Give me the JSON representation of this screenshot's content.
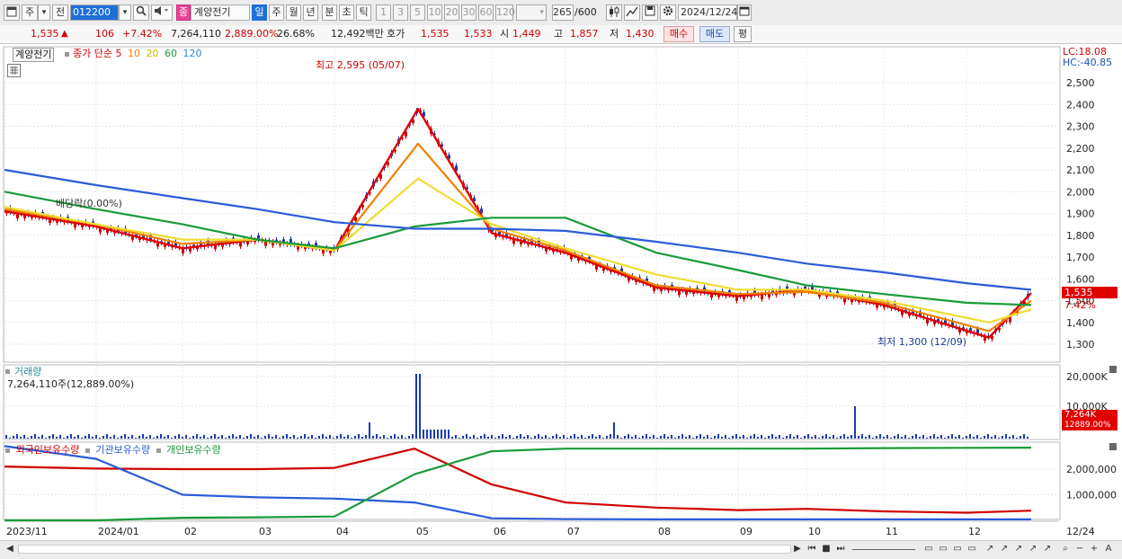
{
  "toolbar": {
    "market": "주",
    "dropdown_arrow": "▾",
    "prev_label": "전",
    "code": "012200",
    "search_icon": "search-icon",
    "sound_icon": "speaker-icon",
    "badge": "종",
    "name": "계양전기",
    "periods": [
      "일",
      "주",
      "월",
      "년",
      "분",
      "초",
      "틱"
    ],
    "selected_period": "일",
    "minute_options": [
      "1",
      "3",
      "5",
      "10",
      "20",
      "30",
      "60",
      "120"
    ],
    "count": "265",
    "count_total": "/600",
    "date": "2024/12/24"
  },
  "info": {
    "price": "1,535",
    "up_icon": "▲",
    "change": "106",
    "change_pct": "+7.42%",
    "volume": "7,264,110",
    "volume_ratio": "2,889.00%",
    "turnover": "26.68%",
    "amount": "12,492백만",
    "quote_label": "호가",
    "ask": "1,535",
    "bid": "1,533",
    "open_label": "시",
    "open": "1,449",
    "high_label": "고",
    "high": "1,857",
    "low_label": "저",
    "low": "1,430",
    "buy_label": "매수",
    "sell_label": "매도",
    "avg_label": "평"
  },
  "legend": {
    "name": "계양전기",
    "title": "종가 단순",
    "mas": [
      {
        "period": "5",
        "color": "#e00000"
      },
      {
        "period": "10",
        "color": "#f08000"
      },
      {
        "period": "20",
        "color": "#e8d000"
      },
      {
        "period": "60",
        "color": "#1a9a3a"
      },
      {
        "period": "120",
        "color": "#2a5bd7"
      }
    ]
  },
  "annotations": {
    "high": "최고 2,595 (05/07)",
    "low": "최저 1,300 (12/09)",
    "dividend": "배당락(0.00%)",
    "lc": "LC:18.08",
    "hc": "HC:-40.85",
    "price_tag": "1,535",
    "pct_tag": "7.42%"
  },
  "volume_panel": {
    "title": "거래량",
    "subtitle": "7,264,110주(12,889.00%)",
    "tag": "7,264K",
    "tag2": "12889.00%"
  },
  "holdings_panel": {
    "series": [
      {
        "name": "외국인보유수량",
        "color": "#d00000"
      },
      {
        "name": "기관보유수량",
        "color": "#2a5bd7"
      },
      {
        "name": "개인보유수량",
        "color": "#1a9a3a"
      }
    ]
  },
  "chart_data": {
    "type": "line",
    "price_axis": [
      "2,500",
      "2,400",
      "2,300",
      "2,200",
      "2,100",
      "2,000",
      "1,900",
      "1,800",
      "1,700",
      "1,600",
      "1,500",
      "1,400",
      "1,300"
    ],
    "volume_axis": [
      "20,000K",
      "10,000K"
    ],
    "holdings_axis": [
      "2,000,000",
      "1,000,000"
    ],
    "x_labels": [
      "2023/11",
      "2024/01",
      "02",
      "03",
      "04",
      "05",
      "06",
      "07",
      "08",
      "09",
      "10",
      "11",
      "12",
      "12/24"
    ],
    "series": [
      {
        "name": "5",
        "x": [
          "2023/11",
          "2024/01",
          "02",
          "03",
          "04",
          "05/07",
          "06",
          "07",
          "08",
          "09",
          "10",
          "11",
          "12/09",
          "12/24"
        ],
        "values": [
          1910,
          1840,
          1740,
          1780,
          1730,
          2380,
          1810,
          1720,
          1560,
          1520,
          1550,
          1480,
          1330,
          1535
        ]
      },
      {
        "name": "10",
        "x": [
          "2023/11",
          "2024/01",
          "02",
          "03",
          "04",
          "05/07",
          "06",
          "07",
          "08",
          "09",
          "10",
          "11",
          "12/09",
          "12/24"
        ],
        "values": [
          1920,
          1850,
          1760,
          1780,
          1730,
          2220,
          1830,
          1730,
          1570,
          1530,
          1540,
          1490,
          1360,
          1500
        ]
      },
      {
        "name": "20",
        "x": [
          "2023/11",
          "2024/01",
          "02",
          "03",
          "04",
          "05/07",
          "06",
          "07",
          "08",
          "09",
          "10",
          "11",
          "12/09",
          "12/24"
        ],
        "values": [
          1930,
          1850,
          1780,
          1780,
          1730,
          2060,
          1850,
          1740,
          1620,
          1550,
          1550,
          1500,
          1400,
          1460
        ]
      },
      {
        "name": "60",
        "x": [
          "2023/11",
          "2024/01",
          "02",
          "03",
          "04",
          "05",
          "06",
          "07",
          "08",
          "09",
          "10",
          "11",
          "12",
          "12/24"
        ],
        "values": [
          2000,
          1920,
          1850,
          1780,
          1740,
          1840,
          1880,
          1880,
          1720,
          1640,
          1570,
          1530,
          1490,
          1480
        ]
      },
      {
        "name": "120",
        "x": [
          "2023/11",
          "2024/01",
          "02",
          "03",
          "04",
          "05",
          "06",
          "07",
          "08",
          "09",
          "10",
          "11",
          "12",
          "12/24"
        ],
        "values": [
          2100,
          2030,
          1970,
          1920,
          1860,
          1830,
          1830,
          1820,
          1770,
          1720,
          1670,
          1630,
          1580,
          1550
        ]
      },
      {
        "name": "외국인보유수량",
        "x": [
          "2023/11",
          "2024/01",
          "02",
          "03",
          "04",
          "05",
          "06",
          "07",
          "08",
          "09",
          "10",
          "11",
          "12",
          "12/24"
        ],
        "values": [
          2100000,
          2020000,
          2000000,
          2000000,
          2050000,
          2800000,
          1400000,
          700000,
          500000,
          400000,
          450000,
          350000,
          300000,
          380000
        ]
      },
      {
        "name": "기관보유수량",
        "x": [
          "2023/11",
          "2024/01",
          "02",
          "03",
          "04",
          "05",
          "06",
          "07",
          "08",
          "09",
          "10",
          "11",
          "12",
          "12/24"
        ],
        "values": [
          2900000,
          2400000,
          1000000,
          900000,
          850000,
          700000,
          80000,
          50000,
          40000,
          40000,
          40000,
          40000,
          40000,
          40000
        ]
      },
      {
        "name": "개인보유수량",
        "x": [
          "2023/11",
          "2024/01",
          "02",
          "03",
          "04",
          "05",
          "06",
          "07",
          "08",
          "09",
          "10",
          "11",
          "12",
          "12/24"
        ],
        "values": [
          0,
          0,
          100000,
          120000,
          150000,
          1800000,
          2700000,
          2800000,
          2800000,
          2800000,
          2800000,
          2820000,
          2830000,
          2840000
        ]
      }
    ]
  }
}
